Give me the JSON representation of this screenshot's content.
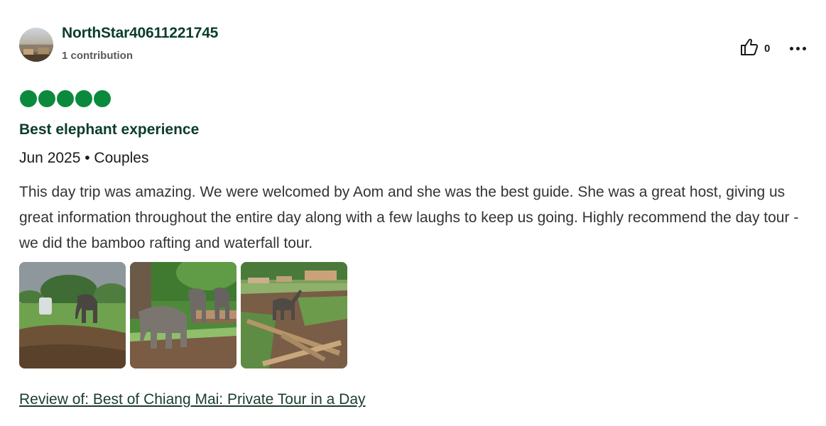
{
  "reviewer": {
    "username": "NorthStar40611221745",
    "contributions": "1 contribution"
  },
  "actions": {
    "helpful_count": "0",
    "helpful_icon": "thumbs-up-icon",
    "more_icon": "more-options-icon"
  },
  "rating": {
    "bubbles": 5,
    "max": 5,
    "color": "#0b8a3e"
  },
  "review": {
    "title": "Best elephant experience",
    "meta": "Jun 2025 • Couples",
    "text": "This day trip was amazing. We were welcomed by Aom and she was the best guide. She was a great host, giving us great information throughout the entire day along with a few laughs to keep us going. Highly recommend the day tour - we did the bamboo rafting and waterfall tour."
  },
  "photos_count": 3,
  "link": {
    "text": "Review of: Best of Chiang Mai: Private Tour in a Day"
  }
}
